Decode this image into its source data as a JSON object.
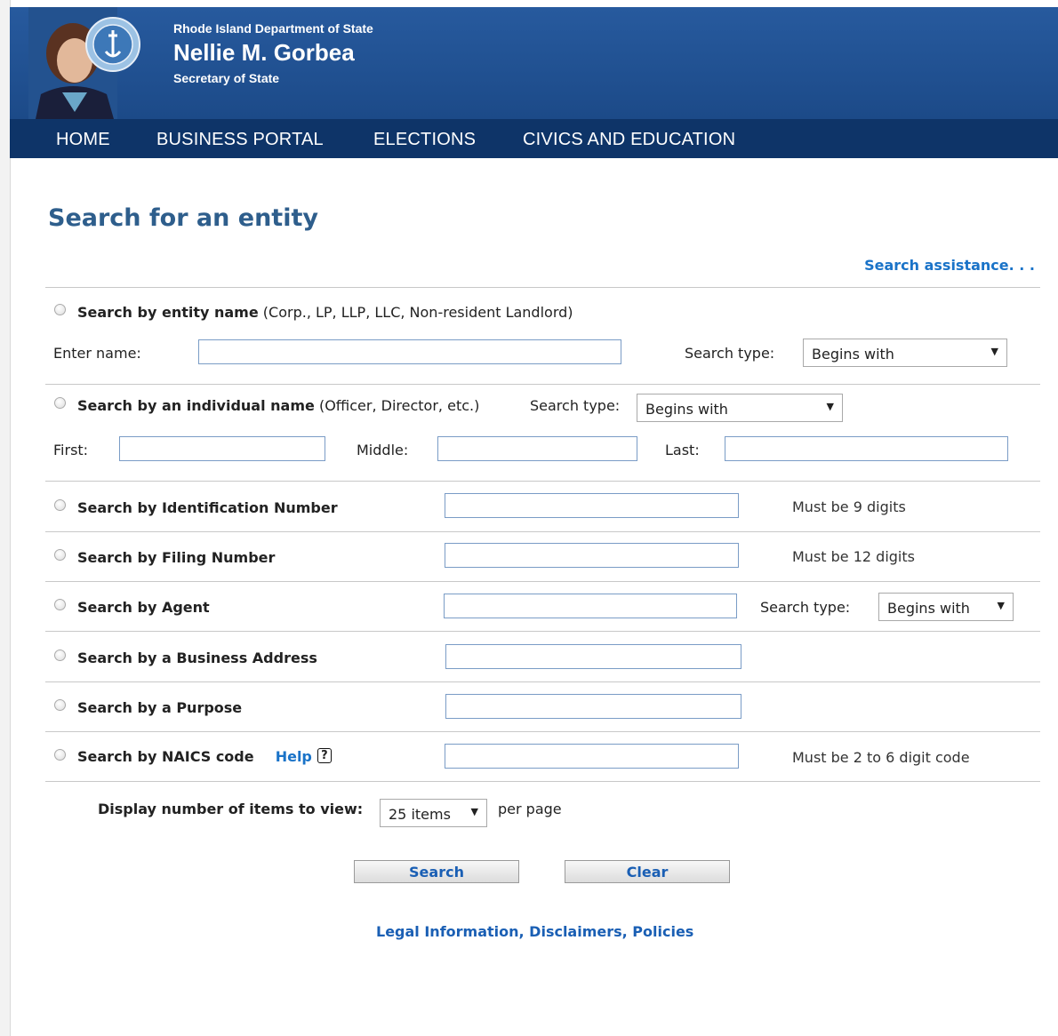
{
  "header": {
    "department": "Rhode Island Department of State",
    "official_name": "Nellie M. Gorbea",
    "official_title": "Secretary of State",
    "colors": {
      "header_blue": "#1f4f8f",
      "nav_blue": "#0e3468"
    }
  },
  "nav": [
    {
      "label": "HOME"
    },
    {
      "label": "BUSINESS PORTAL"
    },
    {
      "label": "ELECTIONS"
    },
    {
      "label": "CIVICS AND EDUCATION"
    }
  ],
  "page": {
    "title": "Search for an entity",
    "assist_link": "Search assistance. . ."
  },
  "form": {
    "entity_name": {
      "label": "Search by entity name",
      "note": "(Corp., LP, LLP, LLC, Non-resident Landlord)",
      "enter_label": "Enter name:",
      "search_type_label": "Search type:",
      "search_type_value": "Begins with"
    },
    "individual": {
      "label": "Search by an individual name",
      "note": "(Officer, Director, etc.)",
      "search_type_label": "Search type:",
      "search_type_value": "Begins with",
      "first_label": "First:",
      "middle_label": "Middle:",
      "last_label": "Last:"
    },
    "id_number": {
      "label": "Search by Identification Number",
      "hint": "Must be 9 digits"
    },
    "filing_number": {
      "label": "Search by Filing Number",
      "hint": "Must be 12 digits"
    },
    "agent": {
      "label": "Search by Agent",
      "search_type_label": "Search type:",
      "search_type_value": "Begins with"
    },
    "address": {
      "label": "Search by a Business Address"
    },
    "purpose": {
      "label": "Search by a Purpose"
    },
    "naics": {
      "label": "Search by NAICS code",
      "help_label": "Help",
      "help_icon": "?",
      "hint": "Must be 2 to 6 digit code"
    },
    "display": {
      "label": "Display number of items to view:",
      "value": "25 items",
      "suffix": "per page"
    },
    "buttons": {
      "search": "Search",
      "clear": "Clear"
    }
  },
  "footer": {
    "link": "Legal Information, Disclaimers, Policies"
  }
}
